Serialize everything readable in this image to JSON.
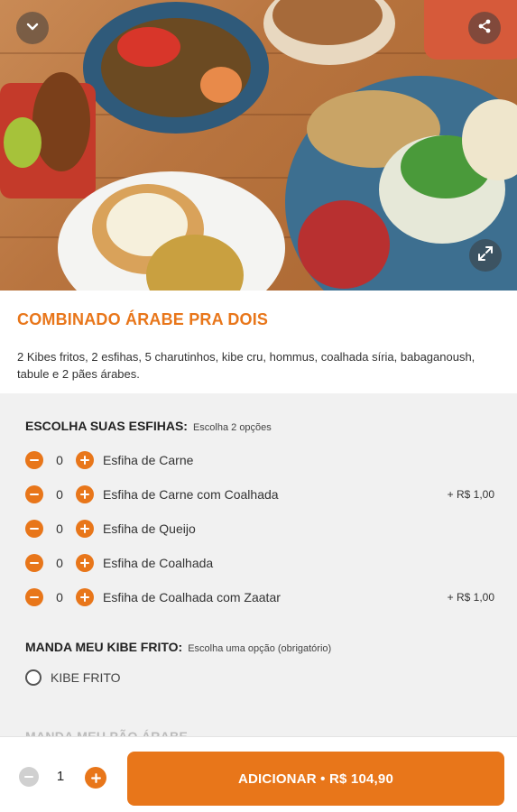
{
  "product": {
    "title": "COMBINADO ÁRABE PRA DOIS",
    "description": "2 Kibes fritos, 2 esfihas, 5 charutinhos, kibe cru, hommus, coalhada síria, babaganoush, tabule e 2 pães árabes."
  },
  "hero": {
    "icons": [
      "chevron-down-icon",
      "share-icon",
      "expand-icon"
    ]
  },
  "esfihas": {
    "title": "ESCOLHA SUAS ESFIHAS:",
    "hint": "Escolha 2 opções",
    "items": [
      {
        "name": "Esfiha de Carne",
        "qty": "0",
        "price": ""
      },
      {
        "name": "Esfiha de Carne com Coalhada",
        "qty": "0",
        "price": "+ R$ 1,00"
      },
      {
        "name": "Esfiha de Queijo",
        "qty": "0",
        "price": ""
      },
      {
        "name": "Esfiha de Coalhada",
        "qty": "0",
        "price": ""
      },
      {
        "name": "Esfiha de Coalhada com Zaatar",
        "qty": "0",
        "price": "+ R$ 1,00"
      }
    ]
  },
  "kibe": {
    "title": "MANDA MEU KIBE FRITO:",
    "hint": "Escolha uma opção (obrigatório)",
    "options": [
      {
        "label": "KIBE FRITO"
      }
    ]
  },
  "next_section": {
    "title": "MANDA MEU PÃO ÁRABE"
  },
  "footer": {
    "qty": "1",
    "add_label": "ADICIONAR • R$ 104,90"
  },
  "colors": {
    "accent": "#e8761a",
    "options_bg": "#f1f1f1"
  }
}
